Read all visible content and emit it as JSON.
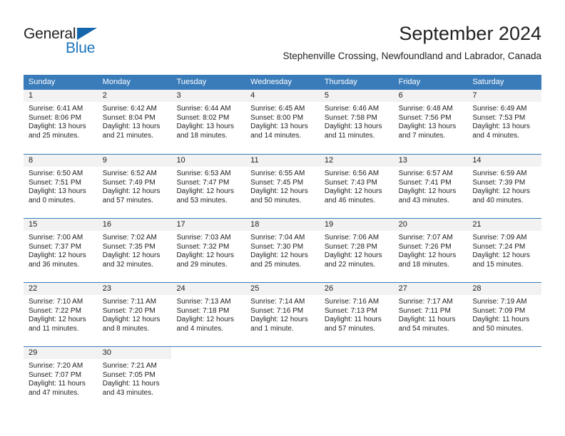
{
  "brand": {
    "name_top": "General",
    "name_bottom": "Blue",
    "triangle_icon": "triangle-icon",
    "color_dark": "#231f20",
    "color_blue": "#1b75bb"
  },
  "header": {
    "month_title": "September 2024",
    "location": "Stephenville Crossing, Newfoundland and Labrador, Canada"
  },
  "theme": {
    "header_blue": "#3a7cba",
    "day_band_gray": "#f2f2f2",
    "text": "#222222"
  },
  "calendar": {
    "weekday_headers": [
      "Sunday",
      "Monday",
      "Tuesday",
      "Wednesday",
      "Thursday",
      "Friday",
      "Saturday"
    ],
    "weeks": [
      [
        {
          "day": "1",
          "sunrise": "Sunrise: 6:41 AM",
          "sunset": "Sunset: 8:06 PM",
          "daylight_1": "Daylight: 13 hours",
          "daylight_2": "and 25 minutes."
        },
        {
          "day": "2",
          "sunrise": "Sunrise: 6:42 AM",
          "sunset": "Sunset: 8:04 PM",
          "daylight_1": "Daylight: 13 hours",
          "daylight_2": "and 21 minutes."
        },
        {
          "day": "3",
          "sunrise": "Sunrise: 6:44 AM",
          "sunset": "Sunset: 8:02 PM",
          "daylight_1": "Daylight: 13 hours",
          "daylight_2": "and 18 minutes."
        },
        {
          "day": "4",
          "sunrise": "Sunrise: 6:45 AM",
          "sunset": "Sunset: 8:00 PM",
          "daylight_1": "Daylight: 13 hours",
          "daylight_2": "and 14 minutes."
        },
        {
          "day": "5",
          "sunrise": "Sunrise: 6:46 AM",
          "sunset": "Sunset: 7:58 PM",
          "daylight_1": "Daylight: 13 hours",
          "daylight_2": "and 11 minutes."
        },
        {
          "day": "6",
          "sunrise": "Sunrise: 6:48 AM",
          "sunset": "Sunset: 7:56 PM",
          "daylight_1": "Daylight: 13 hours",
          "daylight_2": "and 7 minutes."
        },
        {
          "day": "7",
          "sunrise": "Sunrise: 6:49 AM",
          "sunset": "Sunset: 7:53 PM",
          "daylight_1": "Daylight: 13 hours",
          "daylight_2": "and 4 minutes."
        }
      ],
      [
        {
          "day": "8",
          "sunrise": "Sunrise: 6:50 AM",
          "sunset": "Sunset: 7:51 PM",
          "daylight_1": "Daylight: 13 hours",
          "daylight_2": "and 0 minutes."
        },
        {
          "day": "9",
          "sunrise": "Sunrise: 6:52 AM",
          "sunset": "Sunset: 7:49 PM",
          "daylight_1": "Daylight: 12 hours",
          "daylight_2": "and 57 minutes."
        },
        {
          "day": "10",
          "sunrise": "Sunrise: 6:53 AM",
          "sunset": "Sunset: 7:47 PM",
          "daylight_1": "Daylight: 12 hours",
          "daylight_2": "and 53 minutes."
        },
        {
          "day": "11",
          "sunrise": "Sunrise: 6:55 AM",
          "sunset": "Sunset: 7:45 PM",
          "daylight_1": "Daylight: 12 hours",
          "daylight_2": "and 50 minutes."
        },
        {
          "day": "12",
          "sunrise": "Sunrise: 6:56 AM",
          "sunset": "Sunset: 7:43 PM",
          "daylight_1": "Daylight: 12 hours",
          "daylight_2": "and 46 minutes."
        },
        {
          "day": "13",
          "sunrise": "Sunrise: 6:57 AM",
          "sunset": "Sunset: 7:41 PM",
          "daylight_1": "Daylight: 12 hours",
          "daylight_2": "and 43 minutes."
        },
        {
          "day": "14",
          "sunrise": "Sunrise: 6:59 AM",
          "sunset": "Sunset: 7:39 PM",
          "daylight_1": "Daylight: 12 hours",
          "daylight_2": "and 40 minutes."
        }
      ],
      [
        {
          "day": "15",
          "sunrise": "Sunrise: 7:00 AM",
          "sunset": "Sunset: 7:37 PM",
          "daylight_1": "Daylight: 12 hours",
          "daylight_2": "and 36 minutes."
        },
        {
          "day": "16",
          "sunrise": "Sunrise: 7:02 AM",
          "sunset": "Sunset: 7:35 PM",
          "daylight_1": "Daylight: 12 hours",
          "daylight_2": "and 32 minutes."
        },
        {
          "day": "17",
          "sunrise": "Sunrise: 7:03 AM",
          "sunset": "Sunset: 7:32 PM",
          "daylight_1": "Daylight: 12 hours",
          "daylight_2": "and 29 minutes."
        },
        {
          "day": "18",
          "sunrise": "Sunrise: 7:04 AM",
          "sunset": "Sunset: 7:30 PM",
          "daylight_1": "Daylight: 12 hours",
          "daylight_2": "and 25 minutes."
        },
        {
          "day": "19",
          "sunrise": "Sunrise: 7:06 AM",
          "sunset": "Sunset: 7:28 PM",
          "daylight_1": "Daylight: 12 hours",
          "daylight_2": "and 22 minutes."
        },
        {
          "day": "20",
          "sunrise": "Sunrise: 7:07 AM",
          "sunset": "Sunset: 7:26 PM",
          "daylight_1": "Daylight: 12 hours",
          "daylight_2": "and 18 minutes."
        },
        {
          "day": "21",
          "sunrise": "Sunrise: 7:09 AM",
          "sunset": "Sunset: 7:24 PM",
          "daylight_1": "Daylight: 12 hours",
          "daylight_2": "and 15 minutes."
        }
      ],
      [
        {
          "day": "22",
          "sunrise": "Sunrise: 7:10 AM",
          "sunset": "Sunset: 7:22 PM",
          "daylight_1": "Daylight: 12 hours",
          "daylight_2": "and 11 minutes."
        },
        {
          "day": "23",
          "sunrise": "Sunrise: 7:11 AM",
          "sunset": "Sunset: 7:20 PM",
          "daylight_1": "Daylight: 12 hours",
          "daylight_2": "and 8 minutes."
        },
        {
          "day": "24",
          "sunrise": "Sunrise: 7:13 AM",
          "sunset": "Sunset: 7:18 PM",
          "daylight_1": "Daylight: 12 hours",
          "daylight_2": "and 4 minutes."
        },
        {
          "day": "25",
          "sunrise": "Sunrise: 7:14 AM",
          "sunset": "Sunset: 7:16 PM",
          "daylight_1": "Daylight: 12 hours",
          "daylight_2": "and 1 minute."
        },
        {
          "day": "26",
          "sunrise": "Sunrise: 7:16 AM",
          "sunset": "Sunset: 7:13 PM",
          "daylight_1": "Daylight: 11 hours",
          "daylight_2": "and 57 minutes."
        },
        {
          "day": "27",
          "sunrise": "Sunrise: 7:17 AM",
          "sunset": "Sunset: 7:11 PM",
          "daylight_1": "Daylight: 11 hours",
          "daylight_2": "and 54 minutes."
        },
        {
          "day": "28",
          "sunrise": "Sunrise: 7:19 AM",
          "sunset": "Sunset: 7:09 PM",
          "daylight_1": "Daylight: 11 hours",
          "daylight_2": "and 50 minutes."
        }
      ],
      [
        {
          "day": "29",
          "sunrise": "Sunrise: 7:20 AM",
          "sunset": "Sunset: 7:07 PM",
          "daylight_1": "Daylight: 11 hours",
          "daylight_2": "and 47 minutes."
        },
        {
          "day": "30",
          "sunrise": "Sunrise: 7:21 AM",
          "sunset": "Sunset: 7:05 PM",
          "daylight_1": "Daylight: 11 hours",
          "daylight_2": "and 43 minutes."
        },
        {
          "day": "",
          "sunrise": "",
          "sunset": "",
          "daylight_1": "",
          "daylight_2": ""
        },
        {
          "day": "",
          "sunrise": "",
          "sunset": "",
          "daylight_1": "",
          "daylight_2": ""
        },
        {
          "day": "",
          "sunrise": "",
          "sunset": "",
          "daylight_1": "",
          "daylight_2": ""
        },
        {
          "day": "",
          "sunrise": "",
          "sunset": "",
          "daylight_1": "",
          "daylight_2": ""
        },
        {
          "day": "",
          "sunrise": "",
          "sunset": "",
          "daylight_1": "",
          "daylight_2": ""
        }
      ]
    ]
  }
}
